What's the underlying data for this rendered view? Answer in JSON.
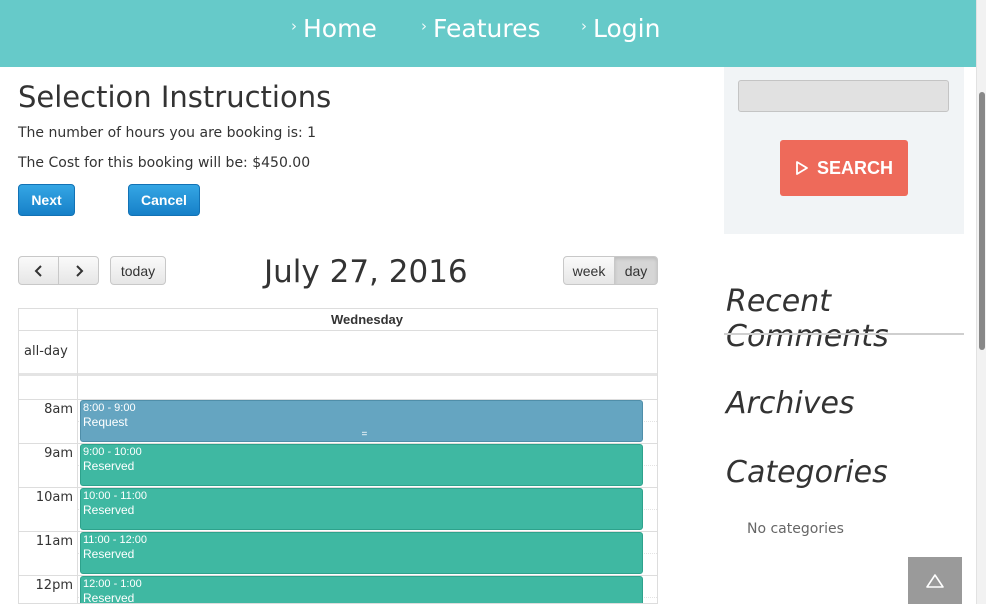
{
  "nav": {
    "items": [
      {
        "label": "Home"
      },
      {
        "label": "Features"
      },
      {
        "label": "Login"
      }
    ],
    "chevron_icon": "chevron-right-icon"
  },
  "colors": {
    "nav_bg": "#66cac9",
    "primary_button": "#1680c8",
    "search_button": "#ee6a5a",
    "event_request": "#65a5c1",
    "event_reserved": "#3fb8a2"
  },
  "selection": {
    "title": "Selection Instructions",
    "hours_text": "The number of hours you are booking is: 1",
    "cost_text": "The Cost for this booking will be: $450.00",
    "next_label": "Next",
    "cancel_label": "Cancel"
  },
  "calendar": {
    "prev_icon": "chevron-left-icon",
    "next_icon": "chevron-right-icon",
    "today_label": "today",
    "title": "July 27, 2016",
    "view_week_label": "week",
    "view_day_label": "day",
    "active_view": "day",
    "day_header": "Wednesday",
    "allday_label": "all-day",
    "time_labels": [
      "8am",
      "9am",
      "10am",
      "11am",
      "12pm"
    ],
    "events": [
      {
        "time": "8:00 - 9:00",
        "title": "Request",
        "status": "request",
        "resizer": "="
      },
      {
        "time": "9:00 - 10:00",
        "title": "Reserved",
        "status": "reserved"
      },
      {
        "time": "10:00 - 11:00",
        "title": "Reserved",
        "status": "reserved"
      },
      {
        "time": "11:00 - 12:00",
        "title": "Reserved",
        "status": "reserved"
      },
      {
        "time": "12:00 - 1:00",
        "title": "Reserved",
        "status": "reserved"
      }
    ]
  },
  "sidebar": {
    "search_input_value": "",
    "search_label": "SEARCH",
    "search_icon": "play-outline-icon",
    "recent_comments_heading": "Recent Comments",
    "archives_heading": "Archives",
    "categories_heading": "Categories",
    "no_categories_text": "No categories",
    "back_to_top_icon": "triangle-up-icon"
  }
}
